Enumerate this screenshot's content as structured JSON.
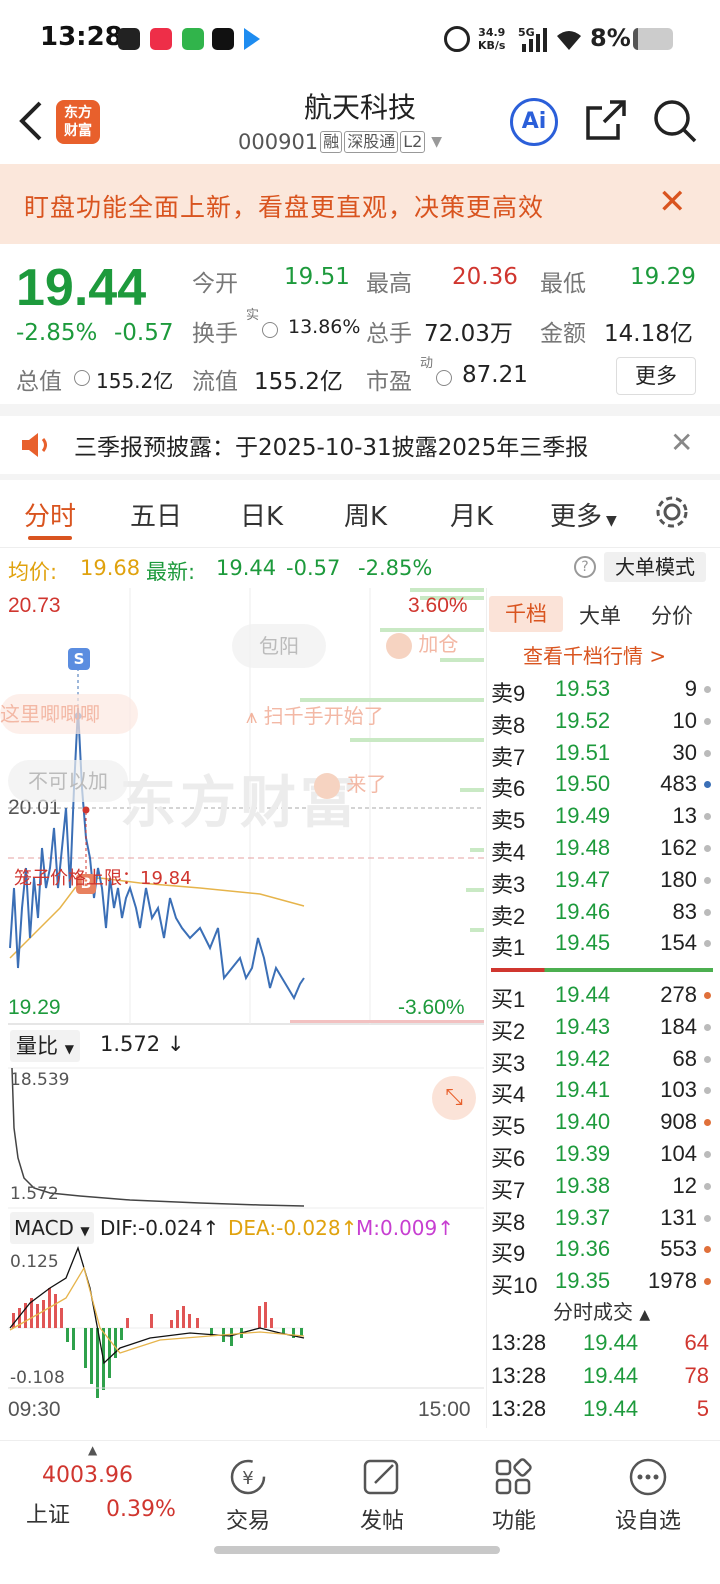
{
  "status": {
    "time": "13:28",
    "net_speed": "34.9",
    "net_unit": "KB/s",
    "signal": "5G",
    "battery": "8%"
  },
  "header": {
    "logo_line1": "东方",
    "logo_line2": "财富",
    "title": "航天科技",
    "code": "000901",
    "tags": [
      "融",
      "深股通",
      "L2"
    ]
  },
  "banner": {
    "text": "盯盘功能全面上新，看盘更直观，决策更高效"
  },
  "quote": {
    "price": "19.44",
    "pct": "-2.85%",
    "chg": "-0.57",
    "open_label": "今开",
    "open": "19.51",
    "high_label": "最高",
    "high": "20.36",
    "low_label": "最低",
    "low": "19.29",
    "turnover_label": "换手",
    "turnover_sup": "实",
    "turnover": "13.86%",
    "volume_label": "总手",
    "volume": "72.03万",
    "amount_label": "金额",
    "amount": "14.18亿",
    "mktcap_label": "总值",
    "mktcap": "155.2亿",
    "float_label": "流值",
    "float": "155.2亿",
    "pe_label": "市盈",
    "pe_sup": "动",
    "pe": "87.21",
    "more": "更多"
  },
  "notice": {
    "text": "三季报预披露：于2025-10-31披露2025年三季报"
  },
  "tabs": [
    "分时",
    "五日",
    "日K",
    "周K",
    "月K",
    "更多"
  ],
  "avgline": {
    "avg_label": "均价:",
    "avg": "19.68",
    "latest_label": "最新:",
    "latest": "19.44",
    "chg": "-0.57",
    "pct": "-2.85%",
    "mode": "大单模式"
  },
  "chart": {
    "top_price": "20.73",
    "top_pct": "3.60%",
    "mid_price": "20.01",
    "bottom_price": "19.29",
    "bottom_pct": "-3.60%",
    "s_marker": "S",
    "b_marker": "B",
    "limit_text": "笼子价格上限：19.84",
    "watermark": "东方财富",
    "bubbles": [
      "包阳",
      "加仓",
      "这里唧唧唧",
      "扫千手开始了",
      "不可以加",
      "来了"
    ],
    "vr_label": "量比",
    "vr_value": "1.572",
    "vr_arrow": "↓",
    "vr_max": "18.539",
    "vr_min": "1.572",
    "macd_label": "MACD",
    "dif": "DIF:-0.024",
    "dif_arrow": "↑",
    "dea": "DEA:-0.028",
    "dea_arrow": "↑",
    "m": "M:0.009",
    "m_arrow": "↑",
    "macd_max": "0.125",
    "macd_min": "-0.108",
    "time_start": "09:30",
    "time_end": "15:00"
  },
  "panel": {
    "tabs": [
      "千档",
      "大单",
      "分价"
    ],
    "link": "查看千档行情 >",
    "sells": [
      {
        "label": "卖9",
        "price": "19.53",
        "vol": "9"
      },
      {
        "label": "卖8",
        "price": "19.52",
        "vol": "10"
      },
      {
        "label": "卖7",
        "price": "19.51",
        "vol": "30"
      },
      {
        "label": "卖6",
        "price": "19.50",
        "vol": "483"
      },
      {
        "label": "卖5",
        "price": "19.49",
        "vol": "13"
      },
      {
        "label": "卖4",
        "price": "19.48",
        "vol": "162"
      },
      {
        "label": "卖3",
        "price": "19.47",
        "vol": "180"
      },
      {
        "label": "卖2",
        "price": "19.46",
        "vol": "83"
      },
      {
        "label": "卖1",
        "price": "19.45",
        "vol": "154"
      }
    ],
    "buys": [
      {
        "label": "买1",
        "price": "19.44",
        "vol": "278"
      },
      {
        "label": "买2",
        "price": "19.43",
        "vol": "184"
      },
      {
        "label": "买3",
        "price": "19.42",
        "vol": "68"
      },
      {
        "label": "买4",
        "price": "19.41",
        "vol": "103"
      },
      {
        "label": "买5",
        "price": "19.40",
        "vol": "908"
      },
      {
        "label": "买6",
        "price": "19.39",
        "vol": "104"
      },
      {
        "label": "买7",
        "price": "19.38",
        "vol": "12"
      },
      {
        "label": "买8",
        "price": "19.37",
        "vol": "131"
      },
      {
        "label": "买9",
        "price": "19.36",
        "vol": "553"
      },
      {
        "label": "买10",
        "price": "19.35",
        "vol": "1978"
      }
    ],
    "trades_title": "分时成交",
    "trades": [
      {
        "time": "13:28",
        "price": "19.44",
        "vol": "64"
      },
      {
        "time": "13:28",
        "price": "19.44",
        "vol": "78"
      },
      {
        "time": "13:28",
        "price": "19.44",
        "vol": "5"
      }
    ]
  },
  "bottomnav": {
    "index_value": "4003.96",
    "index_name": "上证",
    "index_pct": "0.39%",
    "items": [
      "交易",
      "发帖",
      "功能",
      "设自选"
    ]
  }
}
